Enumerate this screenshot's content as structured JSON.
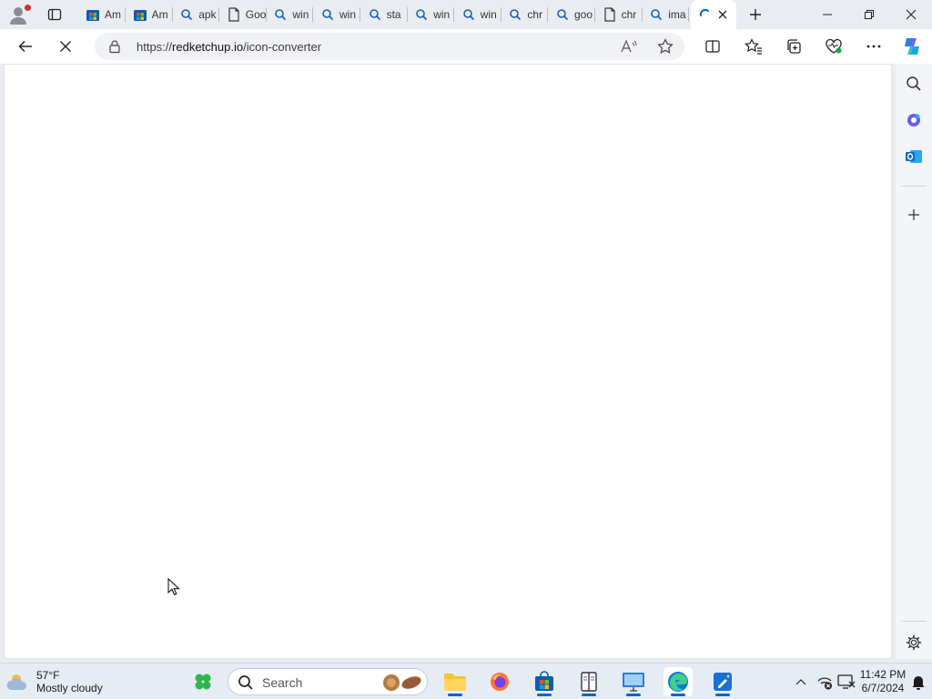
{
  "tabs": [
    {
      "label": "Am",
      "icon": "store-icon"
    },
    {
      "label": "Am",
      "icon": "store-icon"
    },
    {
      "label": "apk",
      "icon": "search-icon"
    },
    {
      "label": "Goo",
      "icon": "document-icon"
    },
    {
      "label": "win",
      "icon": "search-icon"
    },
    {
      "label": "win",
      "icon": "search-icon"
    },
    {
      "label": "sta",
      "icon": "search-icon"
    },
    {
      "label": "win",
      "icon": "search-icon"
    },
    {
      "label": "win",
      "icon": "search-icon"
    },
    {
      "label": "chr",
      "icon": "search-icon"
    },
    {
      "label": "goo",
      "icon": "search-icon"
    },
    {
      "label": "chr",
      "icon": "document-icon"
    },
    {
      "label": "ima",
      "icon": "search-icon"
    }
  ],
  "address_bar": {
    "scheme": "https://",
    "host": "redketchup.io",
    "path": "/icon-converter"
  },
  "weather": {
    "temp": "57°F",
    "condition": "Mostly cloudy"
  },
  "taskbar": {
    "search_placeholder": "Search"
  },
  "clock": {
    "time": "11:42 PM",
    "date": "6/7/2024"
  },
  "colors": {
    "accent": "#0067c0",
    "tab_strip": "#e9edf2",
    "page": "#ffffff"
  }
}
